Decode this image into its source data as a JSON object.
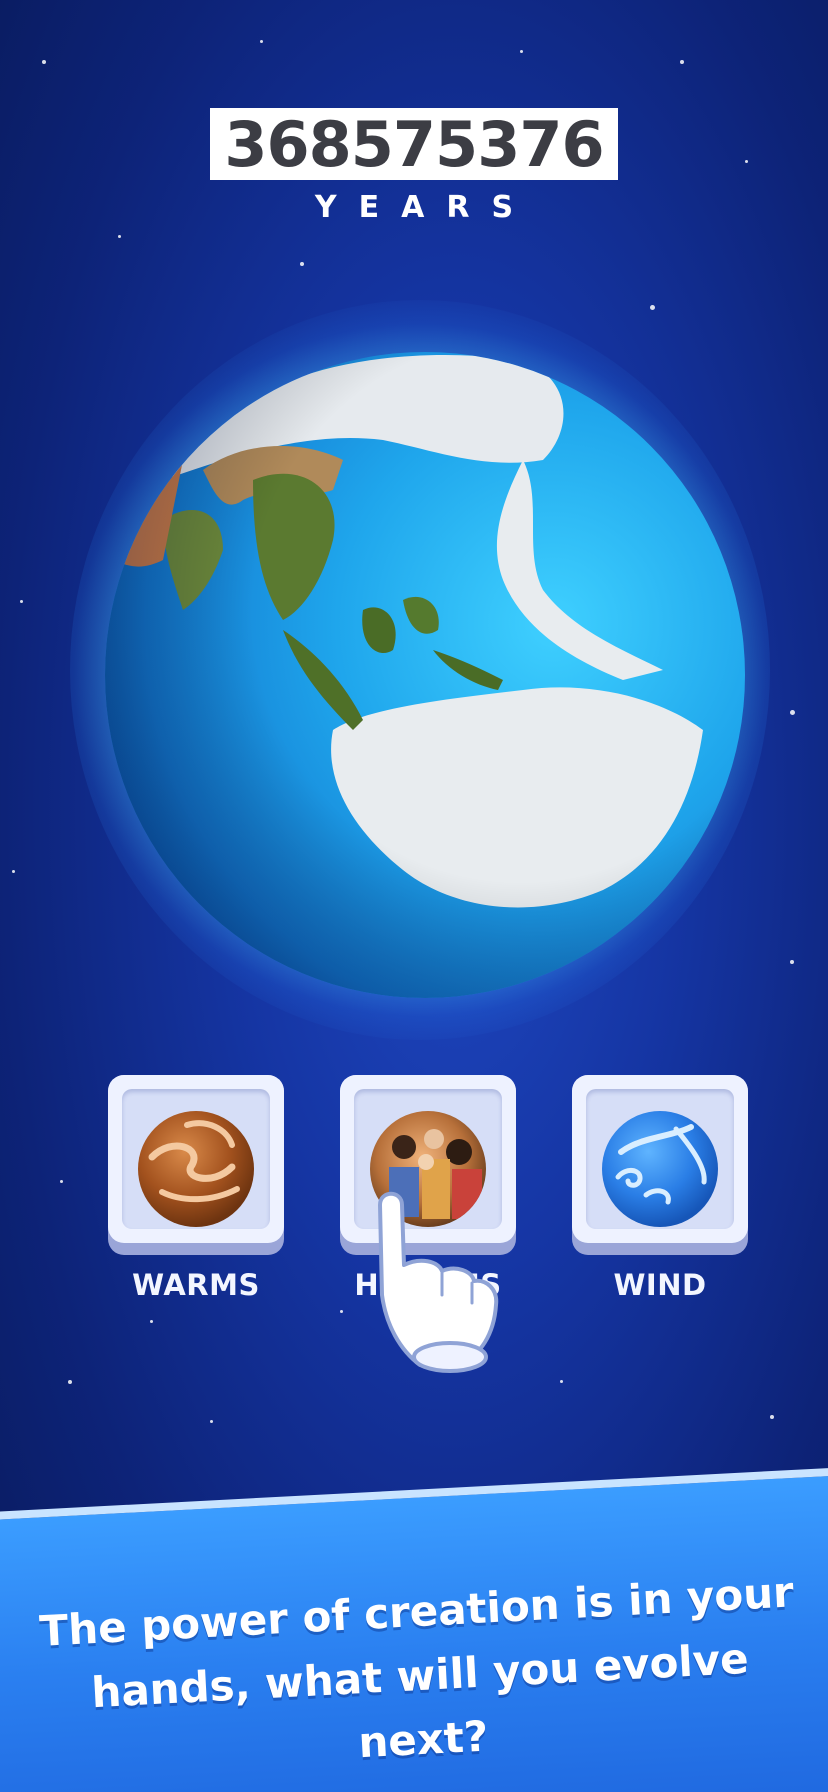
{
  "counter": {
    "value": "368575376",
    "unit_label": "YEARS"
  },
  "globe": {
    "icon": "earth-globe-icon"
  },
  "powers": [
    {
      "label": "WARMS",
      "icon": "warms-orb-icon"
    },
    {
      "label": "HUMANS",
      "icon": "humans-orb-icon"
    },
    {
      "label": "WIND",
      "icon": "wind-orb-icon"
    }
  ],
  "hint": {
    "icon": "tap-hand-icon"
  },
  "banner": {
    "text": "The power of creation is in your hands, what will you evolve next?"
  },
  "colors": {
    "background": "#1535a3",
    "banner": "#2a7ff0",
    "ocean": "#2aa4f0",
    "land": "#e8ecef"
  }
}
